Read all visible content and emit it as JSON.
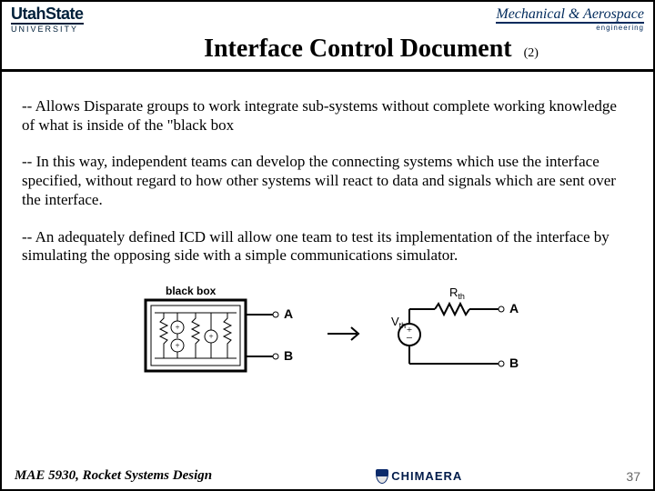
{
  "header": {
    "leftLogoTop": "UtahState",
    "leftLogoBottom": "UNIVERSITY",
    "rightTop": "Mechanical & Aerospace",
    "rightBottom": "engineering"
  },
  "title": {
    "main": "Interface Control Document",
    "sub": "(2)"
  },
  "bullets": {
    "p1": "-- Allows Disparate groups to work integrate sub-systems without complete working knowledge of what is inside of the \"black box",
    "p2": "-- In this way, independent teams can develop the connecting systems which use the interface specified, without regard to how other systems will react to data and signals which are sent over the interface.",
    "p3": "-- An adequately defined ICD will allow one team to test its implementation of the interface by simulating the opposing side with a simple communications simulator."
  },
  "diagram": {
    "boxLabel": "black box",
    "termA": "A",
    "termB": "B",
    "rth": "R",
    "rthSub": "th",
    "vth": "V",
    "vthSub": "th"
  },
  "footer": {
    "course": "MAE 5930, Rocket Systems Design",
    "brand": "CHIMAERA",
    "page": "37"
  }
}
